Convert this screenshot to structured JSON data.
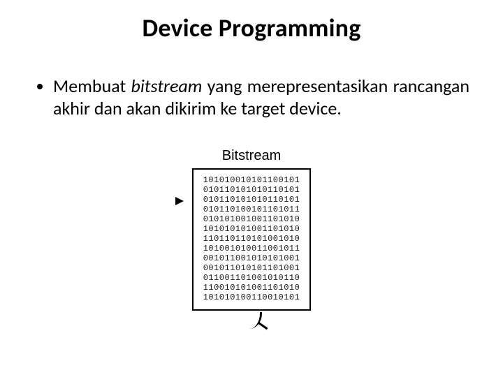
{
  "title": "Device Programming",
  "bullet": {
    "pre": "Membuat ",
    "italic": "bitstream",
    "post": " yang merepresentasikan rancangan akhir dan akan dikirim ke target device."
  },
  "figure": {
    "label": "Bitstream",
    "rows": [
      "101010010101100101",
      "010110101010110101",
      "010110101010110101",
      "010110100101101011",
      "010101001001101010",
      "101010101001101010",
      "110110110101001010",
      "101001010011001011",
      "001011001010101001",
      "001011010101101001",
      "011001101001010110",
      "110010101001101010",
      "101010100110010101"
    ]
  }
}
